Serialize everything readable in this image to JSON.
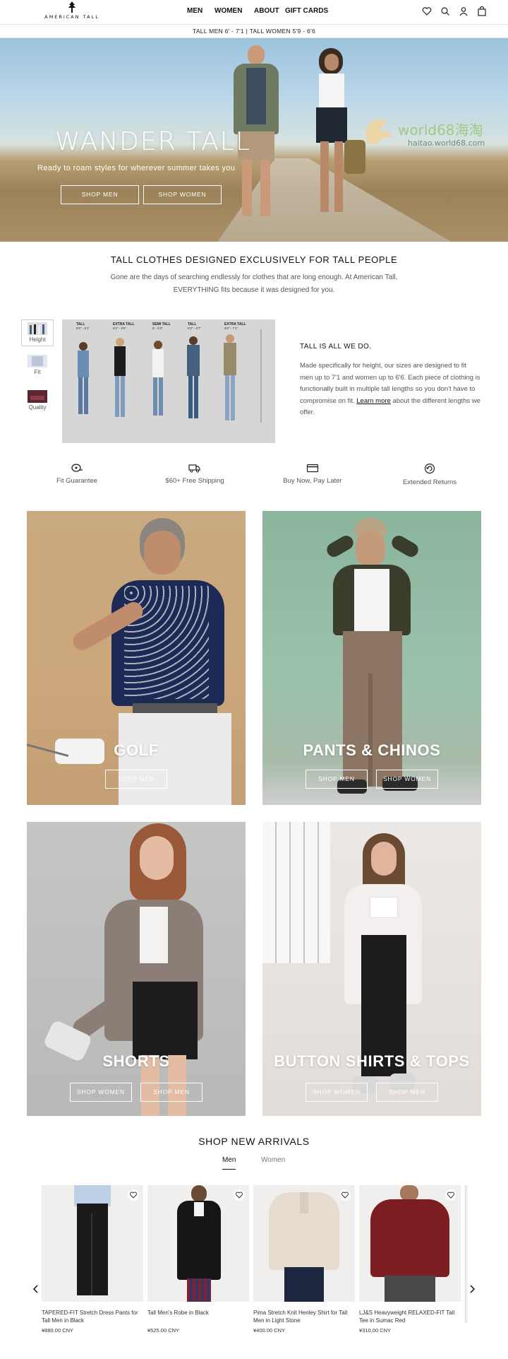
{
  "header": {
    "logo_text": "AMERICAN TALL",
    "nav": [
      "MEN",
      "WOMEN",
      "ABOUT",
      "GIFT CARDS"
    ],
    "icons": [
      "heart-icon",
      "search-icon",
      "user-icon",
      "bag-icon"
    ]
  },
  "topbar": {
    "text": "TALL MEN 6' - 7'1  |  TALL WOMEN 5'9 - 6'6"
  },
  "hero": {
    "title": "WANDER TALL",
    "subtitle": "Ready to roam styles for wherever summer takes you",
    "btn_men": "SHOP MEN",
    "btn_women": "SHOP WOMEN"
  },
  "watermark": {
    "title": "world68海淘",
    "url": "haitao.world68.com"
  },
  "intro": {
    "title": "TALL CLOTHES DESIGNED EXCLUSIVELY FOR TALL PEOPLE",
    "body": "Gone are the days of searching endlessly for clothes that are long enough. At American Tall, EVERYTHING fits because it was designed for you."
  },
  "fit": {
    "thumbs": [
      "Height",
      "Fit",
      "Quality"
    ],
    "size_labels": [
      "TALL",
      "EXTRA TALL",
      "SEMI TALL",
      "TALL",
      "EXTRA TALL"
    ],
    "size_ranges": [
      "5'9\" - 6'1\"",
      "6'2\" - 6'6\"",
      "6' - 6'3\"",
      "6'3\" - 6'7\"",
      "6'8\" - 7'1\""
    ],
    "side_title": "TALL IS ALL WE DO.",
    "side_body_1": "Made specifically for height, our sizes are designed to fit men up to 7'1 and women up to 6'6. Each piece of clothing is functionally built in multiple tall lengths so you don't have to compromise on fit. ",
    "side_link": "Learn more",
    "side_body_2": " about the different lengths we offer."
  },
  "features": [
    "Fit Guarantee",
    "$60+ Free Shipping",
    "Buy Now, Pay Later",
    "Extended Returns"
  ],
  "tiles": [
    {
      "title": "GOLF",
      "buttons": [
        "SHOP MEN"
      ]
    },
    {
      "title": "PANTS & CHINOS",
      "buttons": [
        "SHOP MEN",
        "SHOP WOMEN"
      ]
    },
    {
      "title": "SHORTS",
      "buttons": [
        "SHOP WOMEN",
        "SHOP MEN"
      ]
    },
    {
      "title": "BUTTON SHIRTS & TOPS",
      "buttons": [
        "SHOP WOMEN",
        "SHOP MEN"
      ]
    }
  ],
  "new_arrivals": {
    "title": "SHOP NEW ARRIVALS",
    "tabs": [
      "Men",
      "Women"
    ],
    "products": [
      {
        "name": "TAPERED-FIT Stretch Dress Pants for Tall Men in Black",
        "price": "¥880.00 CNY"
      },
      {
        "name": "Tall Men's Robe in Black",
        "price": "¥525.00 CNY"
      },
      {
        "name": "Pima Stretch Knit Henley Shirt for Tall Men in Light Stone",
        "price": "¥400.00 CNY"
      },
      {
        "name": "LJ&S Heavyweight RELAXED-FIT Tall Tee in Sumac Red",
        "price": "¥310.00 CNY"
      }
    ]
  }
}
